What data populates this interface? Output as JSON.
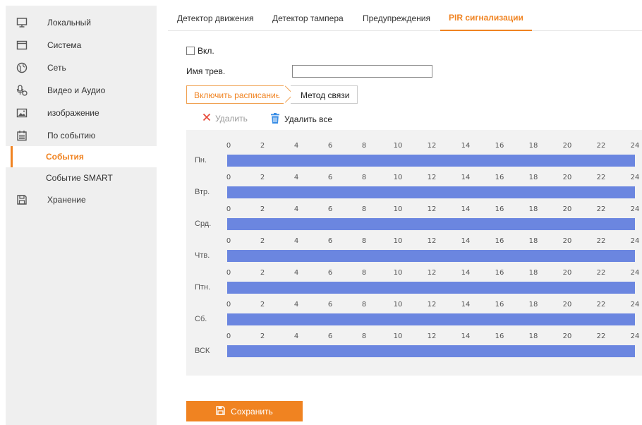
{
  "sidebar": {
    "items": [
      {
        "label": "Локальный",
        "icon": "monitor-icon"
      },
      {
        "label": "Система",
        "icon": "system-window-icon"
      },
      {
        "label": "Сеть",
        "icon": "globe-icon"
      },
      {
        "label": "Видео и Аудио",
        "icon": "microphone-camera-icon"
      },
      {
        "label": "изображение",
        "icon": "image-icon"
      },
      {
        "label": "По событию",
        "icon": "calendar-icon"
      },
      {
        "label": "События",
        "sub": true,
        "active": true
      },
      {
        "label": "Событие SMART",
        "sub": true
      },
      {
        "label": "Хранение",
        "icon": "save-disk-icon"
      }
    ]
  },
  "tabs": [
    {
      "label": "Детектор движения"
    },
    {
      "label": "Детектор тампера"
    },
    {
      "label": "Предупреждения"
    },
    {
      "label": "PIR сигнализации",
      "active": true
    }
  ],
  "form": {
    "enable_label": "Вкл.",
    "enable_checked": false,
    "alarm_name_label": "Имя трев.",
    "alarm_name_value": ""
  },
  "subtabs": {
    "schedule": "Включить расписание",
    "linkage": "Метод связи"
  },
  "actions": {
    "delete": "Удалить",
    "delete_all": "Удалить все"
  },
  "schedule": {
    "days": [
      "Пн.",
      "Втр.",
      "Срд.",
      "Чтв.",
      "Птн.",
      "Сб.",
      "ВСК"
    ],
    "ticks": [
      "0",
      "2",
      "4",
      "6",
      "8",
      "10",
      "12",
      "14",
      "16",
      "18",
      "20",
      "22",
      "24"
    ],
    "bar_color": "#6b86e0",
    "full_day": true
  },
  "save_button": "Сохранить",
  "colors": {
    "accent": "#f08321",
    "schedule_bar": "#6b86e0",
    "sidebar_bg": "#efefef",
    "schedule_bg": "#f2f2f2"
  }
}
